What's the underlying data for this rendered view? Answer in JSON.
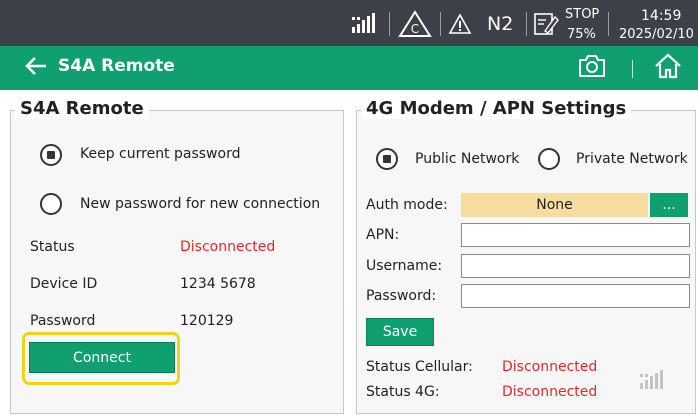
{
  "statusbar": {
    "signal_icon": "cellular-signal-icon",
    "alarm_icon": "c-warning-icon",
    "warning_icon": "warning-icon",
    "mode": "N2",
    "state_icon": "edit-status-icon",
    "state": "STOP",
    "percent": "75%",
    "time": "14:59",
    "date": "2025/02/10"
  },
  "titlebar": {
    "title": "S4A Remote",
    "back_icon": "arrow-left-icon",
    "camera_icon": "camera-icon",
    "home_icon": "home-icon"
  },
  "s4a": {
    "legend": "S4A Remote",
    "options": [
      {
        "label": "Keep current password",
        "checked": true
      },
      {
        "label": "New password for new connection",
        "checked": false
      }
    ],
    "status_label": "Status",
    "status_value": "Disconnected",
    "device_id_label": "Device ID",
    "device_id_value": "1234 5678",
    "password_label": "Password",
    "password_value": "120129",
    "connect_label": "Connect"
  },
  "modem": {
    "legend": "4G Modem / APN Settings",
    "network_options": [
      {
        "label": "Public Network",
        "checked": true
      },
      {
        "label": "Private Network",
        "checked": false
      }
    ],
    "auth_label": "Auth mode:",
    "auth_value": "None",
    "auth_button": "...",
    "apn_label": "APN:",
    "apn_value": "",
    "username_label": "Username:",
    "username_value": "",
    "password_label": "Password:",
    "password_value": "",
    "save_label": "Save",
    "status_cellular_label": "Status Cellular:",
    "status_cellular_value": "Disconnected",
    "status_4g_label": "Status 4G:",
    "status_4g_value": "Disconnected",
    "signal_icon": "no-signal-icon"
  },
  "colors": {
    "statusbar_bg": "#3d4048",
    "accent_green": "#10a070",
    "error_red": "#e02a2a",
    "highlight_yellow": "#f2d31b",
    "auth_field_bg": "#f7dea0"
  }
}
